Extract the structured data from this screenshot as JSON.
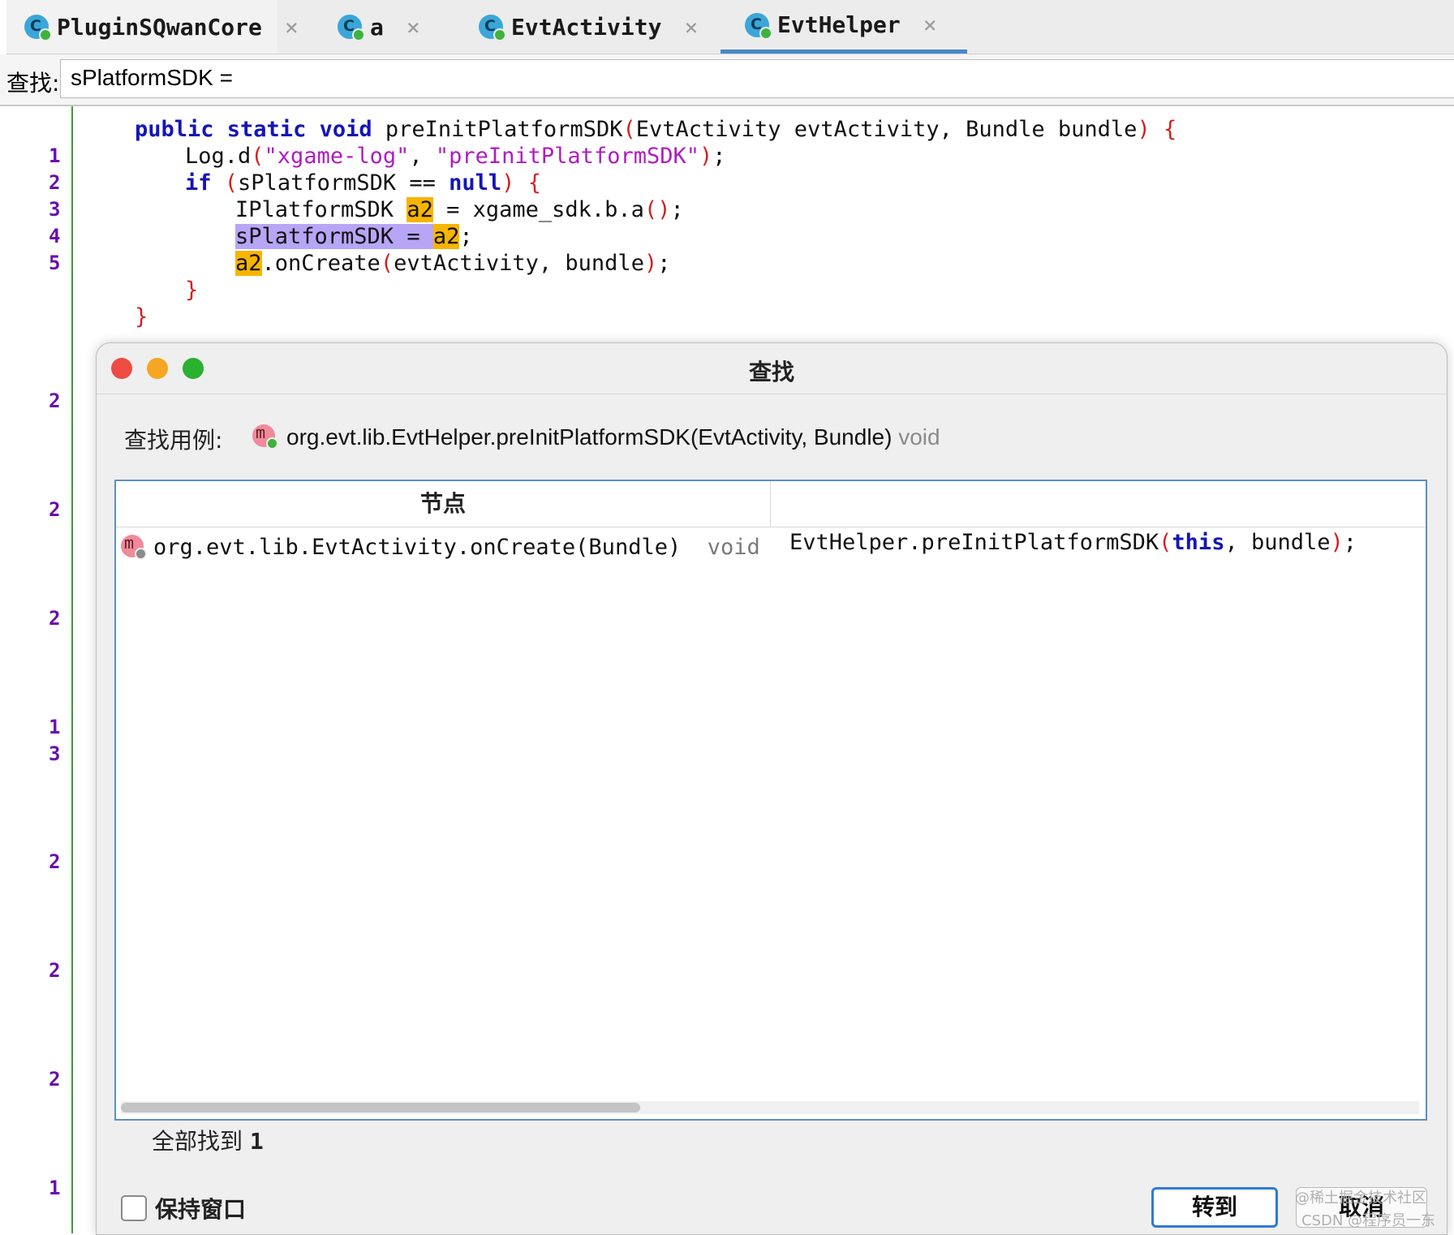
{
  "tabs": [
    {
      "label": "PluginSQwanCore",
      "close": "×"
    },
    {
      "label": "a",
      "close": "×"
    },
    {
      "label": "EvtActivity",
      "close": "×"
    },
    {
      "label": "EvtHelper",
      "close": "×"
    }
  ],
  "active_tab": "EvtHelper",
  "find_bar": {
    "label": "查找:",
    "value": "sPlatformSDK ="
  },
  "editor": {
    "line_numbers": [
      "1",
      "2",
      "3",
      "4",
      "5",
      "2",
      "2",
      "2",
      "1",
      "3",
      "2",
      "2",
      "2",
      "1"
    ],
    "code": {
      "l0": {
        "kw": "public static void",
        "sig": " preInitPlatformSDK",
        "p1": "(",
        "args": "EvtActivity evtActivity, Bundle bundle",
        "p2": ")",
        "brace": " {"
      },
      "l1": {
        "pre": "Log.d",
        "p1": "(",
        "s1": "\"xgame-log\"",
        "comma": ", ",
        "s2": "\"preInitPlatformSDK\"",
        "p2": ")",
        "end": ";"
      },
      "l2": {
        "kw": "if",
        "sp": " ",
        "p1": "(",
        "cond": "sPlatformSDK == ",
        "kw2": "null",
        "p2": ")",
        "brace": " {"
      },
      "l3": {
        "type": "IPlatformSDK ",
        "var": "a2",
        "rest": " = xgame_sdk.b.a",
        "p": "()",
        "end": ";"
      },
      "l4": {
        "sel": "sPlatformSDK = ",
        "var": "a2",
        "end": ";"
      },
      "l5": {
        "var": "a2",
        "rest": ".onCreate",
        "p1": "(",
        "args": "evtActivity, bundle",
        "p2": ")",
        "end": ";"
      },
      "l6": {
        "brace": "}"
      },
      "l7": {
        "brace": "}"
      }
    }
  },
  "dialog": {
    "title": "查找",
    "usage_label": "查找用例:",
    "usage_signature": "org.evt.lib.EvtHelper.preInitPlatformSDK(EvtActivity, Bundle)",
    "usage_return": "void",
    "table": {
      "header_node": "节点",
      "rows": [
        {
          "node": "org.evt.lib.EvtActivity.onCreate(Bundle)",
          "ret": "void",
          "code_pre": "EvtHelper.preInitPlatformSDK",
          "code_p1": "(",
          "code_kw": "this",
          "code_rest": ", bundle",
          "code_p2": ")",
          "code_end": ";"
        }
      ]
    },
    "found_label": "全部找到",
    "found_count": "1",
    "keep_window_label": "保持窗口",
    "goto_button": "转到",
    "cancel_button": "取消"
  },
  "watermark": [
    "@稀土掘金技术社区",
    "CSDN @程序员一东"
  ],
  "colors": {
    "keyword": "#1515b8",
    "string": "#b01cc0",
    "paren": "#d42020",
    "highlight": "#f7b500",
    "selection": "#b7a6f5",
    "accent": "#2f7ad6"
  }
}
